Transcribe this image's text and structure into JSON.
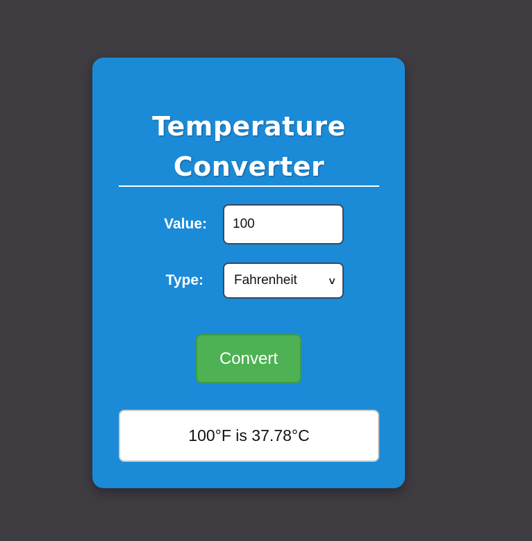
{
  "app": {
    "title_line1": "Temperature",
    "title_line2": "Converter"
  },
  "form": {
    "value_label": "Value:",
    "value_input": "100",
    "type_label": "Type:",
    "type_selected": "Fahrenheit",
    "convert_label": "Convert"
  },
  "result": {
    "text": "100°F is 37.78°C"
  },
  "colors": {
    "background": "#3f3d42",
    "card": "#1b8bd8",
    "button": "#4eb153"
  },
  "icons": {
    "select_chevron": "chevron-down-icon"
  }
}
